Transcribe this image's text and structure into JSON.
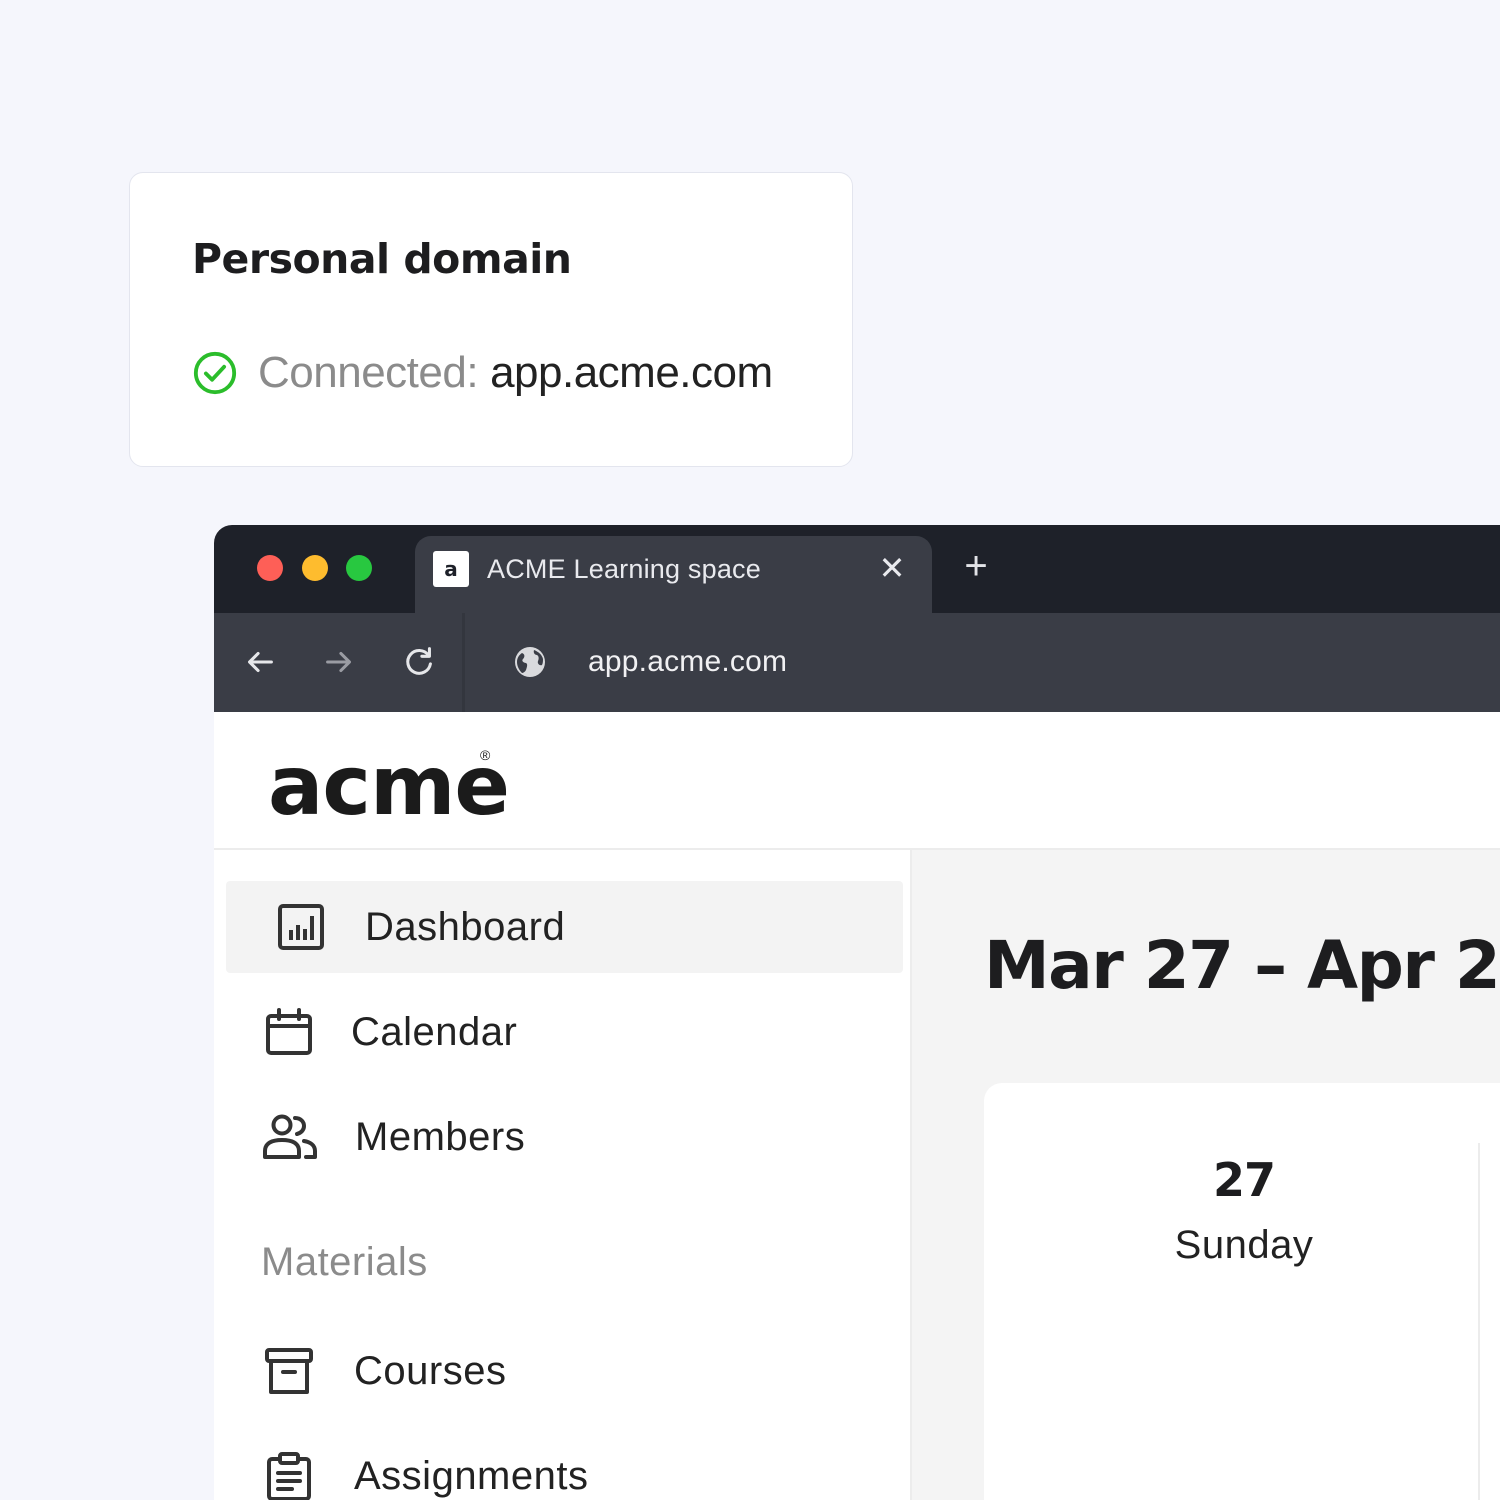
{
  "domain_card": {
    "title": "Personal domain",
    "status_label": "Connected:",
    "status_domain": "app.acme.com",
    "status_color": "#2bbd2b",
    "status_icon": "check-circle-icon"
  },
  "browser": {
    "tab": {
      "favicon_letter": "a",
      "title": "ACME Learning space",
      "close_icon": "close-icon"
    },
    "new_tab_icon": "plus-icon",
    "nav_icons": [
      "arrow-back-icon",
      "arrow-forward-icon",
      "reload-icon"
    ],
    "address_icon": "globe-icon",
    "url": "app.acme.com",
    "colors": {
      "tab_strip": "#1e2129",
      "toolbar": "#3a3d46",
      "traffic_red": "#fe5f57",
      "traffic_yellow": "#febc2e",
      "traffic_green": "#28c840"
    }
  },
  "app": {
    "logo": {
      "text": "acme",
      "mark": "®"
    },
    "sidebar": {
      "items": [
        {
          "label": "Dashboard",
          "icon": "dashboard-icon",
          "active": true
        },
        {
          "label": "Calendar",
          "icon": "calendar-icon",
          "active": false
        },
        {
          "label": "Members",
          "icon": "members-icon",
          "active": false
        }
      ],
      "section_label": "Materials",
      "section_items": [
        {
          "label": "Courses",
          "icon": "archive-box-icon"
        },
        {
          "label": "Assignments",
          "icon": "clipboard-icon"
        }
      ]
    },
    "main": {
      "date_range": "Mar 27 – Apr 2",
      "days": [
        {
          "number": "27",
          "name": "Sunday"
        }
      ]
    }
  }
}
